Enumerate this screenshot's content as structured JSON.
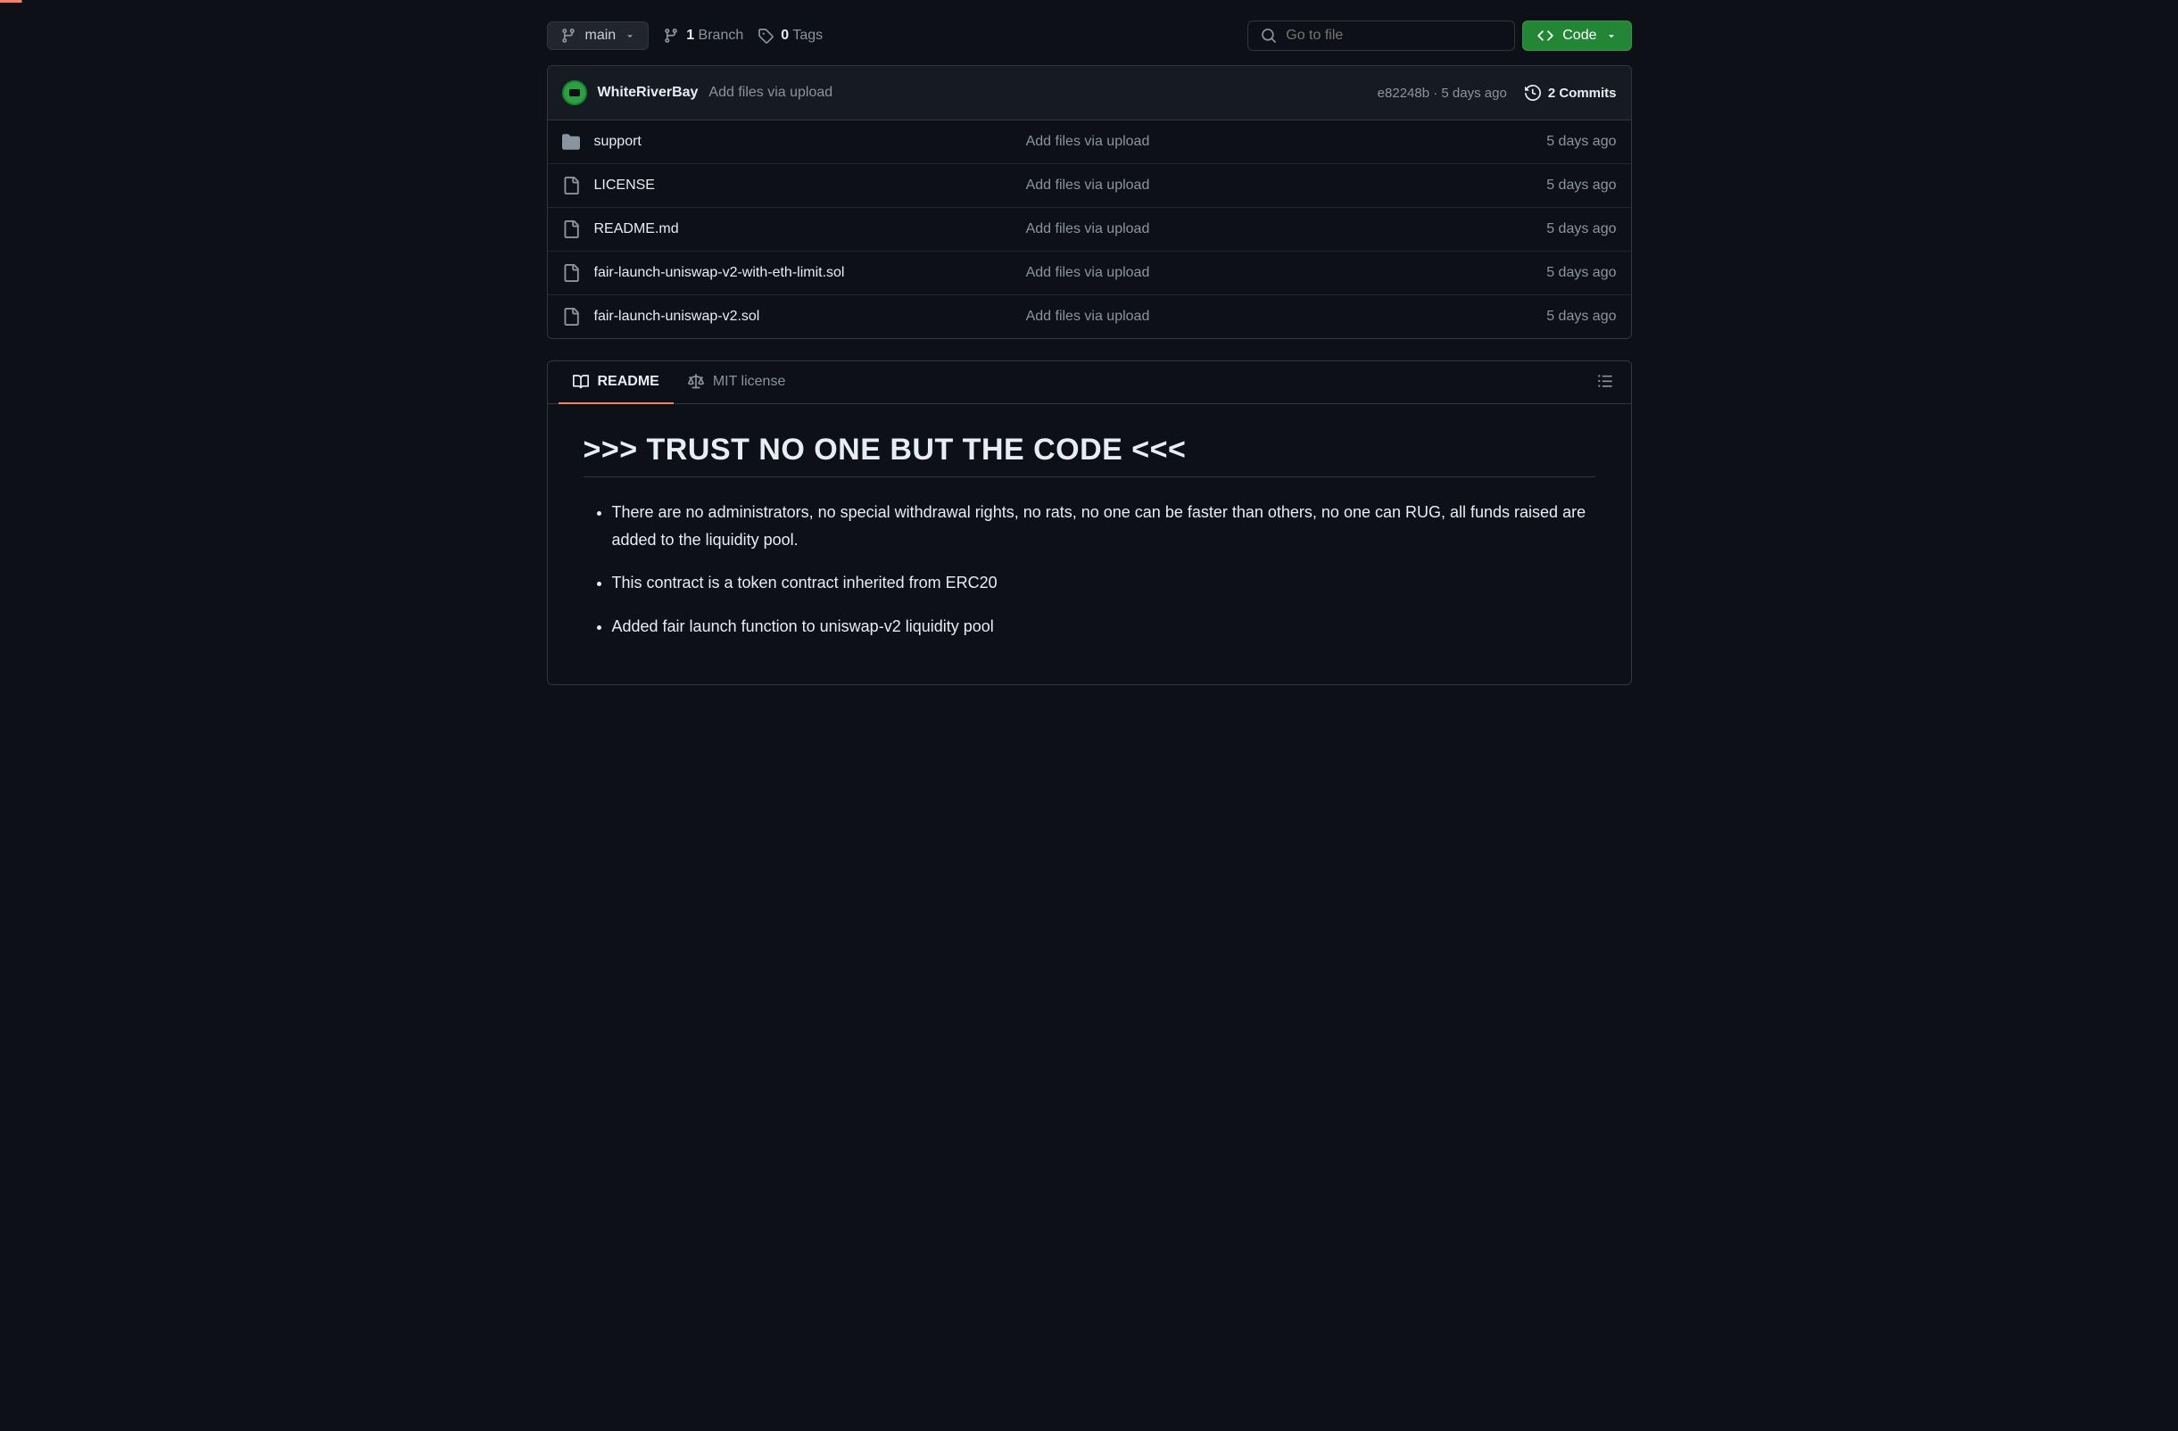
{
  "toolbar": {
    "branch_selector": "main",
    "branch_count": "1",
    "branch_label": "Branch",
    "tag_count": "0",
    "tag_label": "Tags",
    "search_placeholder": "Go to file",
    "code_button": "Code"
  },
  "commit_header": {
    "author": "WhiteRiverBay",
    "message": "Add files via upload",
    "hash": "e82248b",
    "time": "5 days ago",
    "commits_count": "2 Commits"
  },
  "files": [
    {
      "type": "folder",
      "name": "support",
      "message": "Add files via upload",
      "time": "5 days ago"
    },
    {
      "type": "file",
      "name": "LICENSE",
      "message": "Add files via upload",
      "time": "5 days ago"
    },
    {
      "type": "file",
      "name": "README.md",
      "message": "Add files via upload",
      "time": "5 days ago"
    },
    {
      "type": "file",
      "name": "fair-launch-uniswap-v2-with-eth-limit.sol",
      "message": "Add files via upload",
      "time": "5 days ago"
    },
    {
      "type": "file",
      "name": "fair-launch-uniswap-v2.sol",
      "message": "Add files via upload",
      "time": "5 days ago"
    }
  ],
  "readme": {
    "tab_readme": "README",
    "tab_license": "MIT license",
    "heading": ">>> TRUST NO ONE BUT THE CODE <<<",
    "bullets": [
      "There are no administrators, no special withdrawal rights, no rats, no one can be faster than others, no one can RUG, all funds raised are added to the liquidity pool.",
      "This contract is a token contract inherited from ERC20",
      "Added fair launch function to uniswap-v2 liquidity pool"
    ]
  }
}
